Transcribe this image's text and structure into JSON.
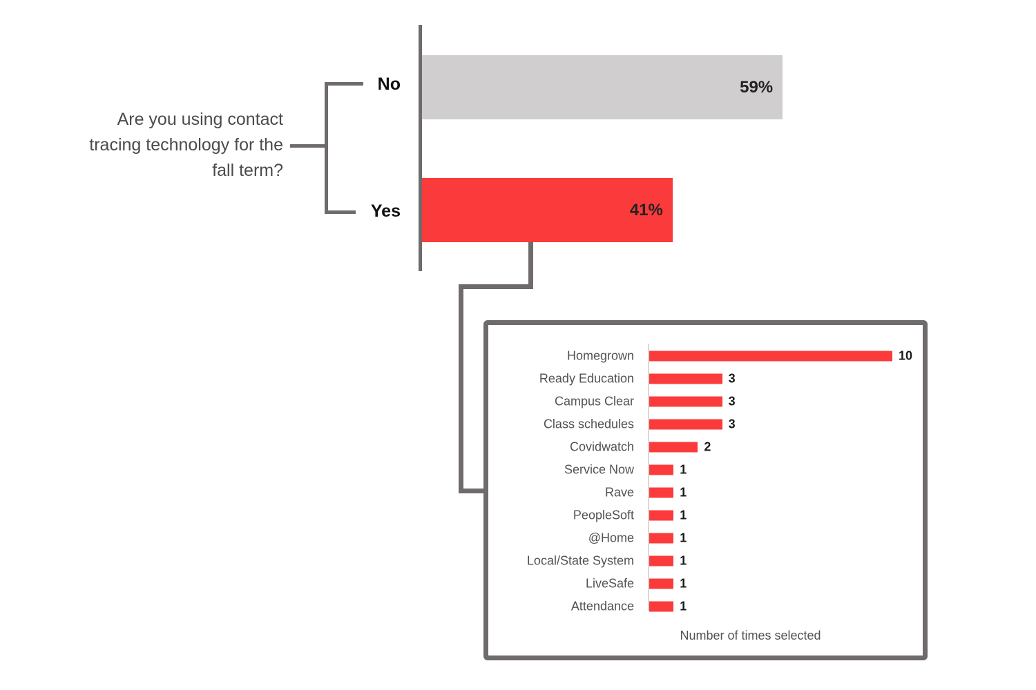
{
  "question": {
    "text": "Are you using contact\ntracing technology for the\nfall term?"
  },
  "colors": {
    "red": "#FB3B3B",
    "gray_bar": "#D0CECE",
    "line_gray": "#6F6B6B",
    "label_gray": "#545151"
  },
  "chart_data": [
    {
      "type": "bar",
      "orientation": "horizontal",
      "title": "Are you using contact tracing technology for the fall term?",
      "xlabel": "",
      "ylabel": "",
      "categories": [
        "No",
        "Yes"
      ],
      "values": [
        59,
        41
      ],
      "value_labels": [
        "59%",
        "41%"
      ],
      "unit": "percent",
      "xlim": [
        0,
        62
      ],
      "grid": false,
      "legend": "none",
      "series_colors": [
        "#D0CECE",
        "#FB3B3B"
      ]
    },
    {
      "type": "bar",
      "orientation": "horizontal",
      "title": "",
      "xlabel": "Number of times selected",
      "ylabel": "",
      "categories": [
        "Homegrown",
        "Ready Education",
        "Campus Clear",
        "Class schedules",
        "Covidwatch",
        "Service Now",
        "Rave",
        "PeopleSoft",
        "@Home",
        "Local/State System",
        "LiveSafe",
        "Attendance"
      ],
      "values": [
        10,
        3,
        3,
        3,
        2,
        1,
        1,
        1,
        1,
        1,
        1,
        1
      ],
      "value_labels": [
        "10",
        "3",
        "3",
        "3",
        "2",
        "1",
        "1",
        "1",
        "1",
        "1",
        "1",
        "1"
      ],
      "unit": "count",
      "xlim": [
        0,
        10
      ],
      "grid": false,
      "legend": "none",
      "series_colors": [
        "#FB3B3B"
      ]
    }
  ],
  "main_chart": {
    "bars": [
      {
        "label": "No",
        "value_label": "59%",
        "value": 59
      },
      {
        "label": "Yes",
        "value_label": "41%",
        "value": 41
      }
    ]
  },
  "detail_chart": {
    "axis_title": "Number of times selected",
    "rows": [
      {
        "label": "Homegrown",
        "value": 10,
        "value_label": "10"
      },
      {
        "label": "Ready Education",
        "value": 3,
        "value_label": "3"
      },
      {
        "label": "Campus Clear",
        "value": 3,
        "value_label": "3"
      },
      {
        "label": "Class schedules",
        "value": 3,
        "value_label": "3"
      },
      {
        "label": "Covidwatch",
        "value": 2,
        "value_label": "2"
      },
      {
        "label": "Service Now",
        "value": 1,
        "value_label": "1"
      },
      {
        "label": "Rave",
        "value": 1,
        "value_label": "1"
      },
      {
        "label": "PeopleSoft",
        "value": 1,
        "value_label": "1"
      },
      {
        "label": "@Home",
        "value": 1,
        "value_label": "1"
      },
      {
        "label": "Local/State System",
        "value": 1,
        "value_label": "1"
      },
      {
        "label": "LiveSafe",
        "value": 1,
        "value_label": "1"
      },
      {
        "label": "Attendance",
        "value": 1,
        "value_label": "1"
      }
    ]
  }
}
